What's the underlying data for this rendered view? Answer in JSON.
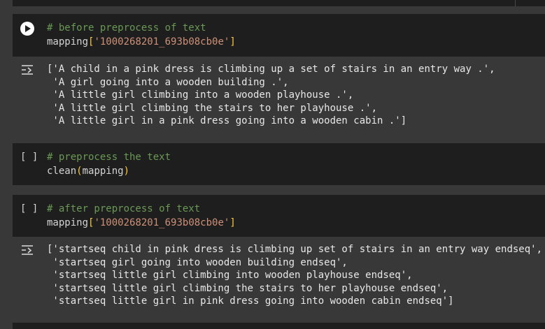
{
  "cells": [
    {
      "code": [
        {
          "comment": "# before preprocess of text"
        },
        {
          "ident": "mapping",
          "open": "[",
          "str": "'1000268201_693b08cb0e'",
          "close": "]"
        }
      ],
      "output": [
        "['A child in a pink dress is climbing up a set of stairs in an entry way .',",
        " 'A girl going into a wooden building .',",
        " 'A little girl climbing into a wooden playhouse .',",
        " 'A little girl climbing the stairs to her playhouse .',",
        " 'A little girl in a pink dress going into a wooden cabin .']"
      ]
    },
    {
      "exec_count": "[ ]",
      "code": [
        {
          "comment": "# preprocess the text"
        },
        {
          "ident": "clean",
          "open": "(",
          "arg": "mapping",
          "close": ")"
        }
      ]
    },
    {
      "exec_count": "[ ]",
      "code": [
        {
          "comment": "# after preprocess of text"
        },
        {
          "ident": "mapping",
          "open": "[",
          "str": "'1000268201_693b08cb0e'",
          "close": "]"
        }
      ],
      "output": [
        "['startseq child in pink dress is climbing up set of stairs in an entry way endseq',",
        " 'startseq girl going into wooden building endseq',",
        " 'startseq little girl climbing into wooden playhouse endseq',",
        " 'startseq little girl climbing the stairs to her playhouse endseq',",
        " 'startseq little girl in pink dress going into wooden cabin endseq']"
      ]
    }
  ],
  "icons": {
    "run": "play-circle-icon",
    "output_toggle": "output-collapse-icon"
  },
  "colors": {
    "page_bg": "#383838",
    "code_bg": "#1e1e1e",
    "comment": "#6a9955",
    "string": "#ce9178",
    "bracket": "#f9c741",
    "text": "#d4d4d4"
  }
}
